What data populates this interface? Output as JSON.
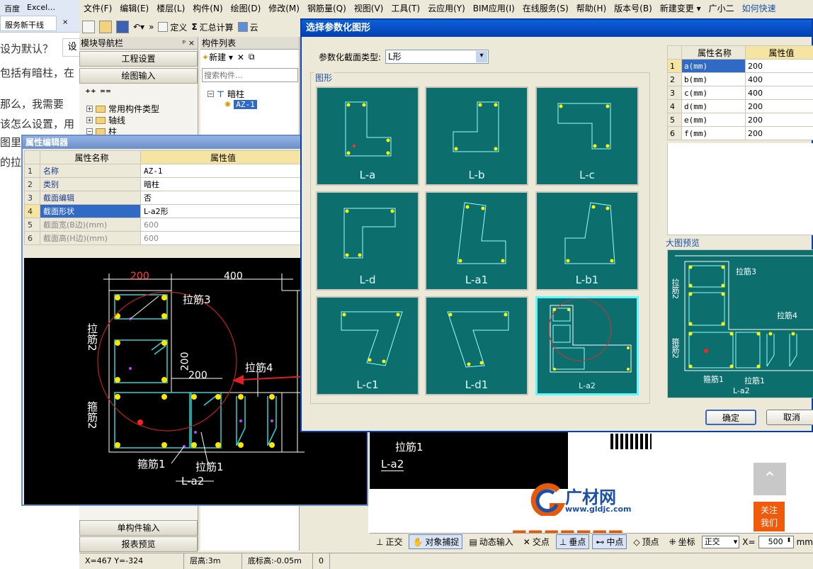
{
  "browser": {
    "tabs": [
      {
        "label": "百度"
      },
      {
        "label": "Excel…"
      },
      {
        "label": "服务新干线"
      }
    ],
    "article_lines": [
      "设为默认？",
      "包括有暗柱，在",
      "那么，我需要",
      "该怎么设置，用",
      "图里",
      "的拉"
    ],
    "button_label": "设"
  },
  "app": {
    "menu": [
      "文件(F)",
      "编辑(E)",
      "楼层(L)",
      "构件(N)",
      "绘图(D)",
      "修改(M)",
      "钢筋量(Q)",
      "视图(V)",
      "工具(T)",
      "云应用(Y)",
      "BIM应用(I)",
      "在线服务(S)",
      "帮助(H)",
      "版本号(B)",
      "新建变更 ▾",
      "广小二",
      "如何快速"
    ],
    "toolbar": {
      "define": "定义",
      "sum_calc": "汇总计算",
      "more": "云"
    },
    "nav_panel": {
      "title": "模块导航栏",
      "btn_project": "工程设置",
      "btn_draw": "绘图输入",
      "tree": [
        "常用构件类型",
        "轴线",
        "柱"
      ],
      "btn_single": "单构件输入",
      "btn_report": "报表预览"
    },
    "comp_list": {
      "title": "构件列表",
      "new_label": "新建",
      "search_placeholder": "搜索构件...",
      "tree_parent": "暗柱",
      "tree_child": "AZ-1"
    },
    "status": {
      "coords": "X=467 Y=-324",
      "floor_height": "层高:3m",
      "base_height": "底标高:-0.05m",
      "zero": "0"
    },
    "snap": {
      "ortho": "正交",
      "snap_obj": "对象捕捉",
      "dyn_input": "动态输入",
      "intersect": "交点",
      "perp": "垂点",
      "mid": "中点",
      "vertex": "顶点",
      "coord": "坐标",
      "mode": "正交",
      "x_label": "X=",
      "x_value": "500",
      "unit": "mm"
    }
  },
  "prop_editor": {
    "title": "属性编辑器",
    "col_name": "属性名称",
    "col_value": "属性值",
    "rows": [
      {
        "n": "1",
        "key": "名称",
        "val": "AZ-1"
      },
      {
        "n": "2",
        "key": "类别",
        "val": "暗柱"
      },
      {
        "n": "3",
        "key": "截面编辑",
        "val": "否"
      },
      {
        "n": "4",
        "key": "截面形状",
        "val": "L-a2形"
      },
      {
        "n": "5",
        "key": "截面宽(B边)(mm)",
        "val": "600"
      },
      {
        "n": "6",
        "key": "截面高(H边)(mm)",
        "val": "600"
      }
    ],
    "cad": {
      "dim_200_top": "200",
      "dim_400_top": "400",
      "dim_400_right": "400",
      "dim_200_right": "200",
      "dim_200_mid_v": "200",
      "dim_200_mid_h": "200",
      "lajin3": "拉筋3",
      "lajin2": "拉筋2",
      "lajin4": "拉筋4",
      "gujin2": "箍筋2",
      "gujin1": "箍筋1",
      "lajin1": "拉筋1",
      "shape": "L-a2"
    }
  },
  "dialog": {
    "title": "选择参数化图形",
    "type_label": "参数化截面类型:",
    "type_value": "L形",
    "group_label": "图形",
    "thumbs": [
      "L-a",
      "L-b",
      "L-c",
      "L-d",
      "L-a1",
      "L-b1",
      "L-c1",
      "L-d1",
      "L-a2"
    ],
    "param_col_name": "属性名称",
    "param_col_value": "属性值",
    "params": [
      {
        "n": "1",
        "key": "a(mm)",
        "val": "200"
      },
      {
        "n": "2",
        "key": "b(mm)",
        "val": "400"
      },
      {
        "n": "3",
        "key": "c(mm)",
        "val": "400"
      },
      {
        "n": "4",
        "key": "d(mm)",
        "val": "200"
      },
      {
        "n": "5",
        "key": "e(mm)",
        "val": "200"
      },
      {
        "n": "6",
        "key": "f(mm)",
        "val": "200"
      }
    ],
    "preview_label": "大图预览",
    "preview": {
      "lajin3": "拉筋3",
      "lajin2": "拉筋2",
      "lajin4": "拉筋4",
      "gujin2": "箍筋2",
      "gujin1": "箍筋1",
      "lajin1": "拉筋1",
      "shape": "L-a2"
    },
    "ok": "确定",
    "cancel": "取消"
  },
  "site": {
    "lajin1": "拉筋1",
    "shape": "L-a2",
    "logo_text": "广材网",
    "logo_url": "www.gldjc.com",
    "follow": "关注\n我们"
  }
}
